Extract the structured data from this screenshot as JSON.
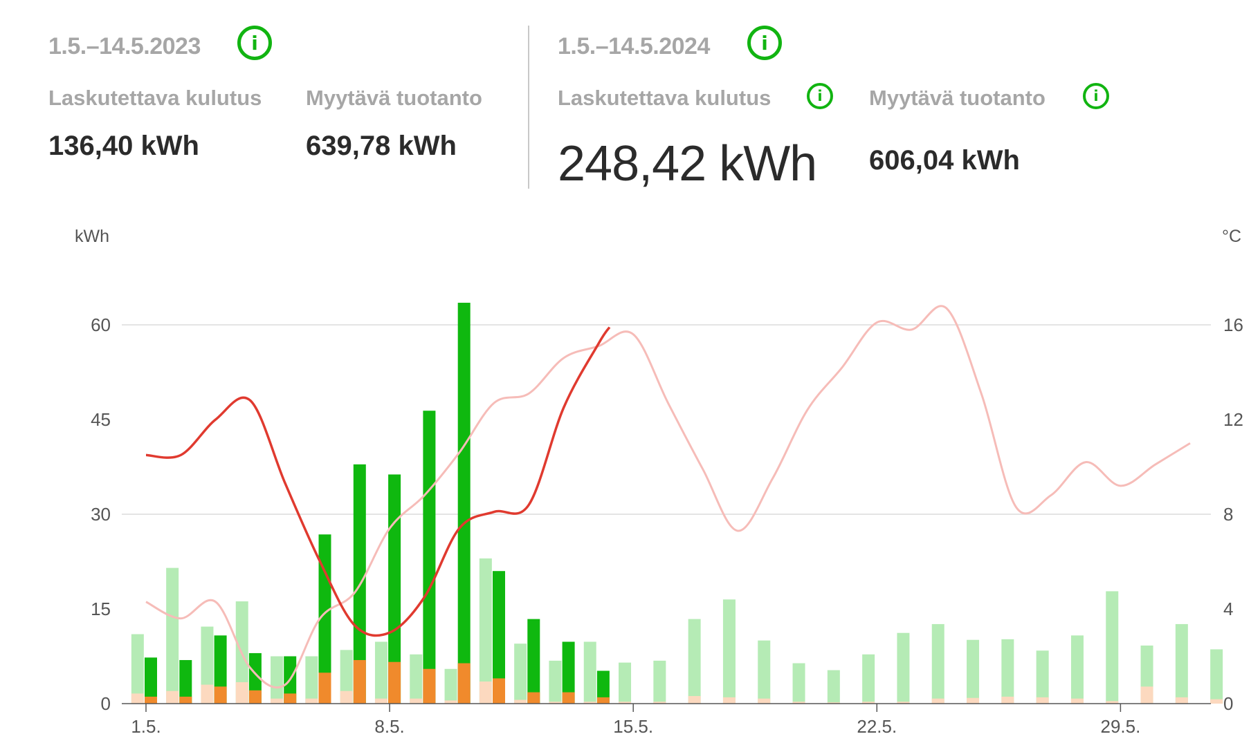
{
  "panels": [
    {
      "period": "1.5.–14.5.2023",
      "metrics": [
        {
          "label": "Laskutettava kulutus",
          "value": "136,40 kWh"
        },
        {
          "label": "Myytävä tuotanto",
          "value": "639,78 kWh"
        }
      ]
    },
    {
      "period": "1.5.–14.5.2024",
      "metrics": [
        {
          "label": "Laskutettava kulutus",
          "value": "248,42 kWh"
        },
        {
          "label": "Myytävä tuotanto",
          "value": "606,04 kWh"
        }
      ]
    }
  ],
  "icons": {
    "info": "info-icon",
    "info_glyph": "i"
  },
  "colors": {
    "production_current": "#0fb80f",
    "production_previous": "#b5ebb5",
    "consumption_current": "#f08a2c",
    "consumption_previous": "#fcd9bf",
    "temperature_current": "#e03a2f",
    "temperature_previous": "#f6bcb8",
    "accent": "#11b411"
  },
  "chart_data": {
    "type": "bar",
    "y_left_unit": "kWh",
    "y_right_unit": "°C",
    "y_left_ticks": [
      "0",
      "15",
      "30",
      "45",
      "60"
    ],
    "y_right_ticks": [
      "0",
      "4",
      "8",
      "12",
      "16"
    ],
    "ylim_left": [
      0,
      60
    ],
    "ylim_right": [
      0,
      16
    ],
    "grid": true,
    "x_ticks": [
      "1.5.",
      "8.5.",
      "15.5.",
      "22.5.",
      "29.5."
    ],
    "days": [
      1,
      2,
      3,
      4,
      5,
      6,
      7,
      8,
      9,
      10,
      11,
      12,
      13,
      14,
      15,
      16,
      17,
      18,
      19,
      20,
      21,
      22,
      23,
      24,
      25,
      26,
      27,
      28,
      29,
      30,
      31
    ],
    "series": [
      {
        "key": "production_previous",
        "values": [
          11,
          21.5,
          12.2,
          16.2,
          7.5,
          7.5,
          8.5,
          9.8,
          7.8,
          5.5,
          23,
          9.5,
          6.8,
          9.8,
          6.5,
          6.8,
          13.4,
          16.5,
          10,
          6.4,
          5.3,
          7.8,
          11.2,
          12.6,
          10.1,
          10.2,
          8.4,
          10.8,
          17.8,
          9.2,
          12.6,
          8.6
        ]
      },
      {
        "key": "consumption_previous",
        "values": [
          1.6,
          2,
          3,
          3.4,
          0.8,
          0.8,
          2,
          0.8,
          0.8,
          0.5,
          3.5,
          0.6,
          0.3,
          0.3,
          0.3,
          0.3,
          1.2,
          1,
          0.8,
          0.3,
          0.2,
          0.3,
          0.3,
          0.8,
          0.9,
          1.1,
          1,
          0.8,
          0.4,
          2.7,
          1,
          0.7
        ]
      },
      {
        "key": "production_current",
        "values": [
          7.3,
          6.9,
          10.8,
          8,
          7.5,
          26.8,
          37.9,
          36.3,
          46.4,
          63.5,
          21,
          13.4,
          9.8,
          5.2
        ]
      },
      {
        "key": "consumption_current",
        "values": [
          1.1,
          1.1,
          2.7,
          2.1,
          1.6,
          4.9,
          6.9,
          6.6,
          5.5,
          6.4,
          4,
          1.8,
          1.8,
          1
        ]
      },
      {
        "key": "temperature_current",
        "values": [
          10.5,
          10.5,
          12,
          12.8,
          9.3,
          6,
          3.3,
          3,
          4.5,
          7.4,
          8.1,
          8.4,
          12.5,
          15.2
        ]
      },
      {
        "key": "temperature_previous",
        "values": [
          4.3,
          3.6,
          4.3,
          1.5,
          0.8,
          3.6,
          4.7,
          7.4,
          8.8,
          10.6,
          12.7,
          13.1,
          14.6,
          15.1,
          15.6,
          12.7,
          9.9,
          7.3,
          9.5,
          12.4,
          14.2,
          16.1,
          15.8,
          16.7,
          13.1,
          8.3,
          8.8,
          10.2,
          9.2,
          10.1,
          11
        ]
      }
    ]
  }
}
